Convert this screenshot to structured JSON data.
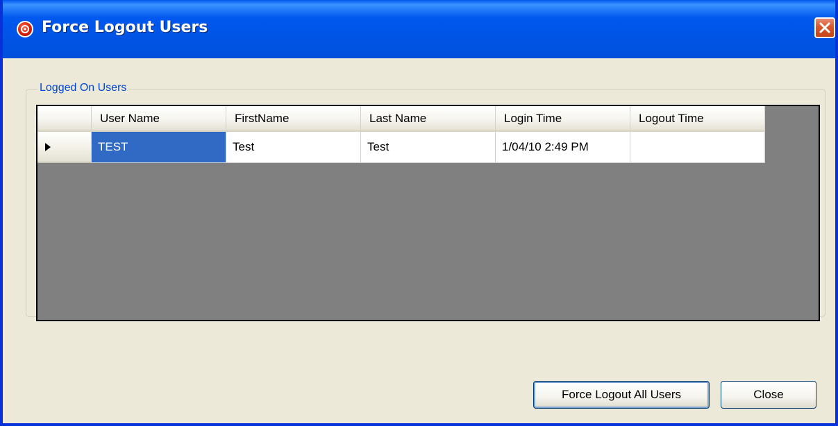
{
  "window": {
    "title": "Force Logout Users",
    "icon": "app-logo-icon",
    "close_icon": "close-icon"
  },
  "group": {
    "legend": "Logged On Users"
  },
  "grid": {
    "columns": [
      "User Name",
      "FirstName",
      "Last Name",
      "Login Time",
      "Logout Time"
    ],
    "rows": [
      {
        "user_name": "TEST",
        "first_name": "Test",
        "last_name": "Test",
        "login_time": "1/04/10 2:49 PM",
        "logout_time": "",
        "current": true,
        "selected_cell": "user_name"
      }
    ]
  },
  "buttons": {
    "force_logout_all": "Force Logout All Users",
    "close": "Close"
  },
  "colors": {
    "titlebar": "#0055E5",
    "selection": "#316AC5",
    "legend_text": "#0046D5",
    "grid_background": "#808080",
    "dialog_background": "#ECE9D8"
  }
}
